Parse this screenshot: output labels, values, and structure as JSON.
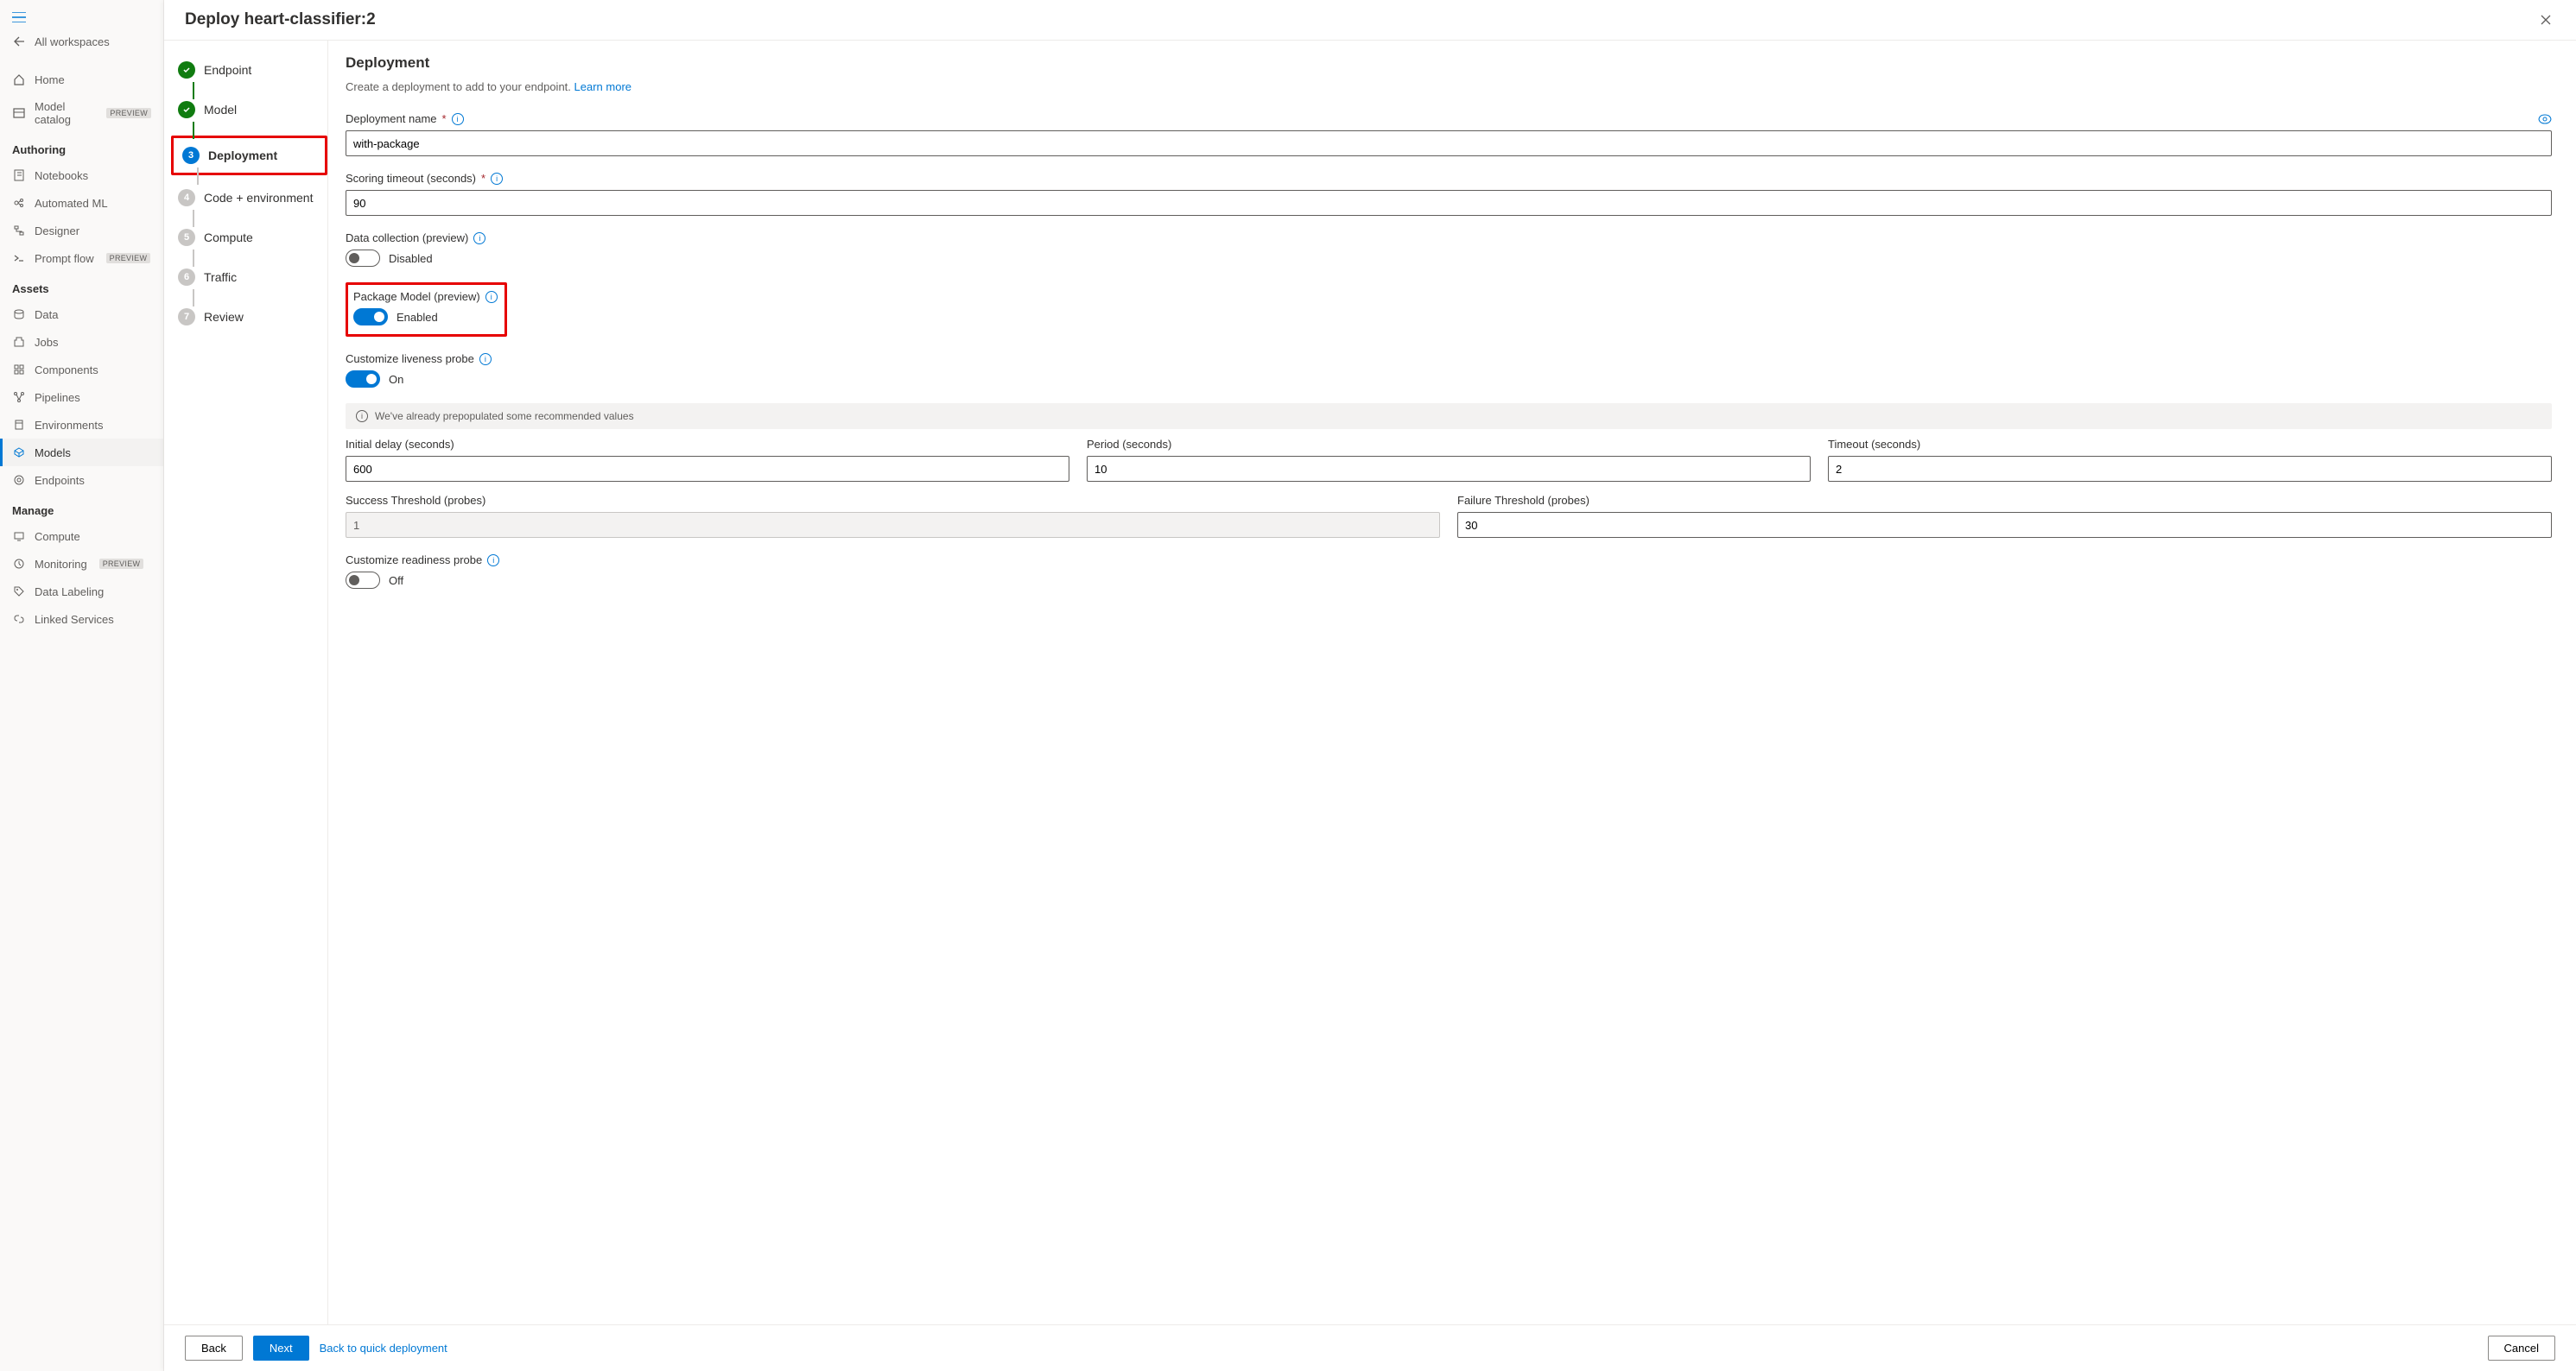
{
  "sidebar": {
    "allWorkspaces": "All workspaces",
    "home": "Home",
    "modelCatalog": "Model catalog",
    "previewBadge": "PREVIEW",
    "sections": {
      "authoring": "Authoring",
      "assets": "Assets",
      "manage": "Manage"
    },
    "authoring": {
      "notebooks": "Notebooks",
      "automatedML": "Automated ML",
      "designer": "Designer",
      "promptFlow": "Prompt flow"
    },
    "assets": {
      "data": "Data",
      "jobs": "Jobs",
      "components": "Components",
      "pipelines": "Pipelines",
      "environments": "Environments",
      "models": "Models",
      "endpoints": "Endpoints"
    },
    "manage": {
      "compute": "Compute",
      "monitoring": "Monitoring",
      "dataLabeling": "Data Labeling",
      "linkedServices": "Linked Services"
    }
  },
  "panel": {
    "title": "Deploy heart-classifier:2"
  },
  "stepper": {
    "steps": [
      {
        "label": "Endpoint",
        "state": "done"
      },
      {
        "label": "Model",
        "state": "done"
      },
      {
        "label": "Deployment",
        "state": "current",
        "num": "3"
      },
      {
        "label": "Code + environment",
        "state": "pending",
        "num": "4"
      },
      {
        "label": "Compute",
        "state": "pending",
        "num": "5"
      },
      {
        "label": "Traffic",
        "state": "pending",
        "num": "6"
      },
      {
        "label": "Review",
        "state": "pending",
        "num": "7"
      }
    ]
  },
  "form": {
    "sectionTitle": "Deployment",
    "sectionDesc": "Create a deployment to add to your endpoint.",
    "learnMore": "Learn more",
    "deploymentName": {
      "label": "Deployment name",
      "value": "with-package"
    },
    "scoringTimeout": {
      "label": "Scoring timeout (seconds)",
      "value": "90"
    },
    "dataCollection": {
      "label": "Data collection (preview)",
      "state": "Disabled"
    },
    "packageModel": {
      "label": "Package Model (preview)",
      "state": "Enabled"
    },
    "livenessProbe": {
      "label": "Customize liveness probe",
      "state": "On"
    },
    "infoBar": "We've already prepopulated some recommended values",
    "initialDelay": {
      "label": "Initial delay (seconds)",
      "value": "600"
    },
    "period": {
      "label": "Period (seconds)",
      "value": "10"
    },
    "timeout": {
      "label": "Timeout (seconds)",
      "value": "2"
    },
    "successThreshold": {
      "label": "Success Threshold (probes)",
      "value": "1"
    },
    "failureThreshold": {
      "label": "Failure Threshold (probes)",
      "value": "30"
    },
    "readinessProbe": {
      "label": "Customize readiness probe",
      "state": "Off"
    }
  },
  "footer": {
    "back": "Back",
    "next": "Next",
    "quickDeploy": "Back to quick deployment",
    "cancel": "Cancel"
  }
}
